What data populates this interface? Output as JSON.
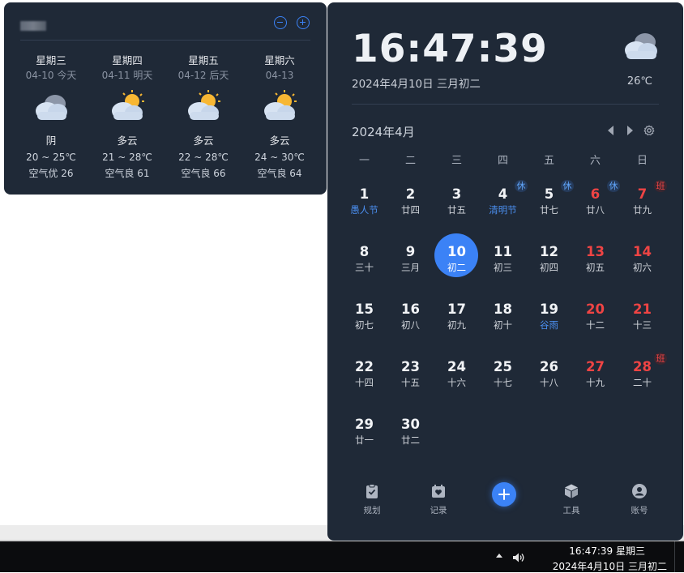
{
  "weather": {
    "days": [
      {
        "weekday": "星期三",
        "date": "04-10 今天",
        "condition": "阴",
        "temp": "20 ~ 25℃",
        "air": "空气优 26",
        "icon": "cloudy-icon"
      },
      {
        "weekday": "星期四",
        "date": "04-11 明天",
        "condition": "多云",
        "temp": "21 ~ 28℃",
        "air": "空气良 61",
        "icon": "partly-cloudy-icon"
      },
      {
        "weekday": "星期五",
        "date": "04-12 后天",
        "condition": "多云",
        "temp": "22 ~ 28℃",
        "air": "空气良 66",
        "icon": "partly-cloudy-icon"
      },
      {
        "weekday": "星期六",
        "date": "04-13",
        "condition": "多云",
        "temp": "24 ~ 30℃",
        "air": "空气良 64",
        "icon": "partly-cloudy-icon"
      }
    ]
  },
  "panel": {
    "time": "16:47:39",
    "date": "2024年4月10日 三月初二",
    "temperature": "26℃",
    "month": "2024年4月",
    "weekdays": [
      "一",
      "二",
      "三",
      "四",
      "五",
      "六",
      "日"
    ],
    "days": [
      {
        "d": "1",
        "l": "愚人节",
        "fest": true
      },
      {
        "d": "2",
        "l": "廿四"
      },
      {
        "d": "3",
        "l": "廿五"
      },
      {
        "d": "4",
        "l": "清明节",
        "fest": true,
        "tag": "休",
        "tagType": "rest"
      },
      {
        "d": "5",
        "l": "廿七",
        "tag": "休",
        "tagType": "rest"
      },
      {
        "d": "6",
        "l": "廿八",
        "red": true,
        "tag": "休",
        "tagType": "rest"
      },
      {
        "d": "7",
        "l": "廿九",
        "red": true,
        "tag": "班",
        "tagType": "work"
      },
      {
        "d": "8",
        "l": "三十"
      },
      {
        "d": "9",
        "l": "三月"
      },
      {
        "d": "10",
        "l": "初二",
        "today": true
      },
      {
        "d": "11",
        "l": "初三"
      },
      {
        "d": "12",
        "l": "初四"
      },
      {
        "d": "13",
        "l": "初五",
        "red": true
      },
      {
        "d": "14",
        "l": "初六",
        "red": true
      },
      {
        "d": "15",
        "l": "初七"
      },
      {
        "d": "16",
        "l": "初八"
      },
      {
        "d": "17",
        "l": "初九"
      },
      {
        "d": "18",
        "l": "初十"
      },
      {
        "d": "19",
        "l": "谷雨",
        "fest": true
      },
      {
        "d": "20",
        "l": "十二",
        "red": true
      },
      {
        "d": "21",
        "l": "十三",
        "red": true
      },
      {
        "d": "22",
        "l": "十四"
      },
      {
        "d": "23",
        "l": "十五"
      },
      {
        "d": "24",
        "l": "十六"
      },
      {
        "d": "25",
        "l": "十七"
      },
      {
        "d": "26",
        "l": "十八"
      },
      {
        "d": "27",
        "l": "十九",
        "red": true
      },
      {
        "d": "28",
        "l": "二十",
        "red": true,
        "tag": "班",
        "tagType": "work"
      },
      {
        "d": "29",
        "l": "廿一"
      },
      {
        "d": "30",
        "l": "廿二"
      }
    ],
    "bottom_bar": [
      {
        "label": "规划",
        "icon": "clipboard-check-icon"
      },
      {
        "label": "记录",
        "icon": "calendar-heart-icon"
      },
      {
        "label": "",
        "icon": "plus-icon"
      },
      {
        "label": "工具",
        "icon": "box-icon"
      },
      {
        "label": "账号",
        "icon": "user-circle-icon"
      }
    ]
  },
  "taskbar": {
    "time": "16:47:39 星期三",
    "date": "2024年4月10日 三月初二"
  },
  "colors": {
    "panel_bg": "#1f2937",
    "accent": "#3b82f6",
    "holiday_red": "#ef4444",
    "festival_blue": "#4b8ff0"
  }
}
